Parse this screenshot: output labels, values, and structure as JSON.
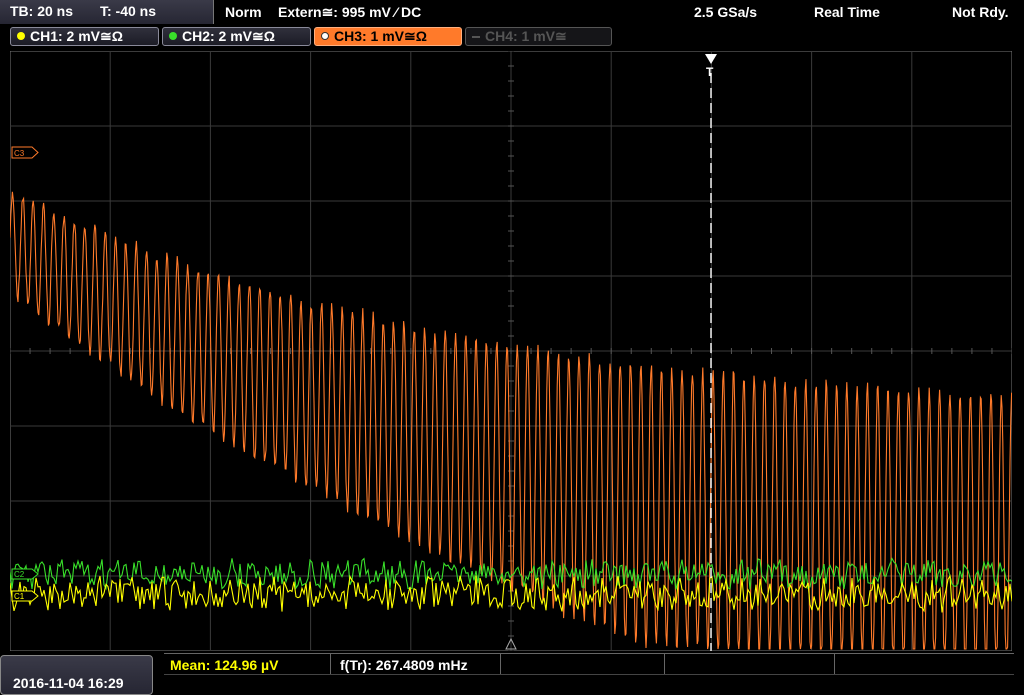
{
  "status": {
    "timebase": "TB: 20 ns",
    "trigger_offset": "T: -40 ns",
    "trigger_mode": "Norm",
    "trigger_source": "Extern≅: 995 mV ⁄ DC",
    "sample_rate": "2.5 GSa/s",
    "acq_mode": "Real Time",
    "run_state": "Not Rdy."
  },
  "channels": [
    {
      "label": "CH1: 2 mV≅Ω",
      "color": "#ffff00",
      "state": "on"
    },
    {
      "label": "CH2: 2 mV≅Ω",
      "color": "#39e02a",
      "state": "on"
    },
    {
      "label": "CH3: 1 mV≅Ω",
      "color": "#ff7a2a",
      "state": "selected"
    },
    {
      "label": "CH4: 1 mV≅",
      "color": "#555555",
      "state": "off"
    }
  ],
  "markers": {
    "ch3_ref": "C3",
    "ch2_ref": "C2",
    "ch1_ref": "C1",
    "trigger": "T"
  },
  "measurements": {
    "mean": "Mean: 124.96 µV",
    "freq": "f(Tr): 267.4809 mHz"
  },
  "datetime": "2016-11-04 16:29",
  "colors": {
    "ch1": "#ffff00",
    "ch2": "#39e02a",
    "ch3": "#ff7a2a",
    "grid": "#3a3a3a"
  }
}
